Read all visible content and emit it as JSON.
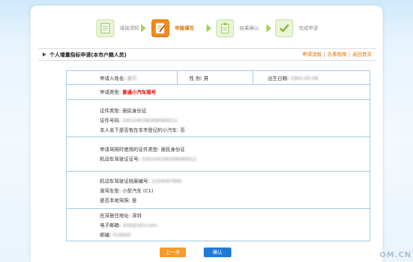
{
  "steps": [
    {
      "label": "填报须知",
      "icon": "document-icon",
      "state": "done"
    },
    {
      "label": "申报填写",
      "icon": "edit-icon",
      "state": "active"
    },
    {
      "label": "结果确认",
      "icon": "clipboard-icon",
      "state": "pending"
    },
    {
      "label": "完成申请",
      "icon": "checkmark-icon",
      "state": "pending"
    }
  ],
  "header": {
    "title": "个人增量指标申请(本市户籍人员)",
    "links": [
      "申请流程",
      "办事指南",
      "返回首页"
    ]
  },
  "form": {
    "name_label": "申请人姓名:",
    "name_value": "崔可",
    "gender_label": "性  别:",
    "gender_value": "男",
    "birth_label": "出生日期:",
    "birth_value": "1983-05-06",
    "type_label": "申请类型:",
    "type_value": "普通小汽车摇号",
    "id_type_label": "证件类型:",
    "id_type_value": "居民身份证",
    "id_no_label": "证件号码:",
    "id_no_value": "330104198306060011",
    "car_owned_label": "本人名下是否有在本市登记的小汽车:",
    "car_owned_value": "否",
    "lic_id_type_label": "申请驾照时使用的证件类型:",
    "lic_id_type_value": "居民身份证",
    "lic_no_label": "机动车驾驶证证号:",
    "lic_no_value": "330104198306060011",
    "archive_label": "机动车驾驶证档案编号:",
    "archive_value": "1234567890",
    "drive_type_label": "准驾车型:",
    "drive_type_value": "小型汽车 (C1)",
    "local_label": "是否本地驾照:",
    "local_value": "是",
    "address_label": "在深居住地址:",
    "address_value": "深圳",
    "email_label": "电子邮箱:",
    "email_value": "326@163.com",
    "zip_label": "邮编:",
    "zip_value": "518000"
  },
  "buttons": {
    "prev": "上一步",
    "confirm": "确认"
  },
  "watermark": "OM.CN",
  "colors": {
    "accent": "#f08a1c",
    "primary": "#1f7ad6",
    "border": "#9cc8e0",
    "highlight": "#e60000"
  }
}
